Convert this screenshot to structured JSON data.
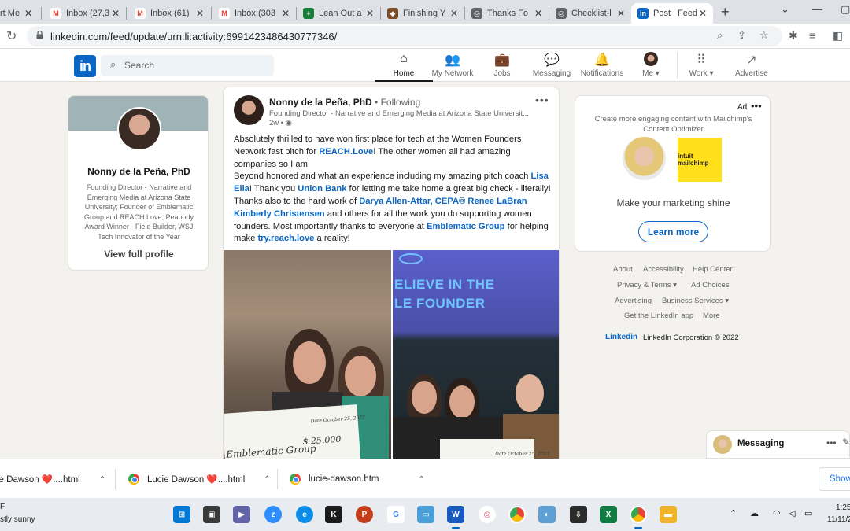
{
  "browser": {
    "tabs": [
      {
        "label": "rt Me",
        "icon": "generic-tab-icon",
        "color": "#5f6368"
      },
      {
        "label": "Inbox (27,3",
        "icon": "gmail-icon",
        "color": "#ea4335"
      },
      {
        "label": "Inbox (61)",
        "icon": "gmail-icon",
        "color": "#ea4335"
      },
      {
        "label": "Inbox (303",
        "icon": "gmail-icon",
        "color": "#ea4335"
      },
      {
        "label": "Lean Out a",
        "icon": "sheets-icon",
        "color": "#188038"
      },
      {
        "label": "Finishing Y",
        "icon": "box-icon",
        "color": "#7a4e2a"
      },
      {
        "label": "Thanks Fo",
        "icon": "globe-icon",
        "color": "#5f6368"
      },
      {
        "label": "Checklist-l",
        "icon": "globe-icon",
        "color": "#5f6368"
      },
      {
        "label": "Post | Feed",
        "icon": "linkedin-icon",
        "color": "#0a66c2"
      }
    ],
    "url": "linkedin.com/feed/update/urn:li:activity:6991423486430777346/"
  },
  "nav": {
    "search_placeholder": "Search",
    "items": [
      {
        "label": "Home",
        "icon": "⌂"
      },
      {
        "label": "My Network",
        "icon": "👥"
      },
      {
        "label": "Jobs",
        "icon": "💼"
      },
      {
        "label": "Messaging",
        "icon": "💬"
      },
      {
        "label": "Notifications",
        "icon": "🔔"
      },
      {
        "label": "Me ▾",
        "icon": ""
      },
      {
        "label": "Work ▾",
        "icon": "⠿"
      },
      {
        "label": "Advertise",
        "icon": "↗"
      }
    ],
    "logo": "in"
  },
  "profile": {
    "name": "Nonny de la Peña, PhD",
    "description": "Founding Director - Narrative and Emerging Media at Arizona State University; Founder of Emblematic Group and REACH.Love, Peabody Award Winner - Field Builder, WSJ Tech Innovator of the Year",
    "view_label": "View full profile"
  },
  "post": {
    "author": "Nonny de la Peña, PhD",
    "following": " • Following",
    "headline": "Founding Director - Narrative and Emerging Media at Arizona State Universit...",
    "time": "2w •",
    "paragraphs": {
      "p1a": "Absolutely thrilled to have won first place for tech at the Women Founders Network fast pitch for ",
      "p1link": "REACH.Love",
      "p1b": "! The other women all had amazing companies so I am",
      "p2a": "Beyond honored and what an experience including my amazing pitch coach ",
      "p2link1": "Lisa Elia",
      "p2b": "! Thank you ",
      "p2link2": "Union Bank",
      "p2c": " for letting me take home a great big check - literally!",
      "p3a": "Thanks also to the hard work of ",
      "p3link1": "Darya Allen-Attar, CEPA®",
      "p3link2": "Renee LaBran",
      "p3link3": "Kimberly Christensen",
      "p3b": " and others for all the work you do supporting women founders. Most importantly thanks to everyone at ",
      "p3link4": "Emblematic Group",
      "p3c": " for helping make ",
      "p3link5": "try.reach.love",
      "p3d": " a reality!"
    },
    "photo1_check_payee": "Emblematic Group",
    "photo1_check_amount": "$ 25,000",
    "photo1_check_date": "Date October 25, 2022",
    "photo2_banner_line1": "ELIEVE IN THE",
    "photo2_banner_line2": "LE FOUNDER",
    "photo2_check_date": "Date October 25, 2022"
  },
  "ad": {
    "label": "Ad",
    "line": "Create more engaging content with Mailchimp's Content Optimizer",
    "brand": "intuit mailchimp",
    "headline": "Make your marketing shine",
    "button": "Learn more"
  },
  "footer": {
    "links": [
      "About",
      "Accessibility",
      "Help Center",
      "Privacy & Terms ▾",
      "Ad Choices",
      "Advertising",
      "Business Services ▾",
      "Get the LinkedIn app",
      "More"
    ],
    "logo": "Linkedin",
    "corp": "LinkedIn Corporation © 2022"
  },
  "messaging": {
    "label": "Messaging"
  },
  "downloads": {
    "items": [
      "ie Dawson ❤️....html",
      "Lucie Dawson ❤️....html",
      "lucie-dawson.htm"
    ],
    "show_all": "Show"
  },
  "taskbar": {
    "weather_temp": "F",
    "weather_desc": "stly sunny",
    "time": "1:25",
    "date": "11/11/2"
  }
}
